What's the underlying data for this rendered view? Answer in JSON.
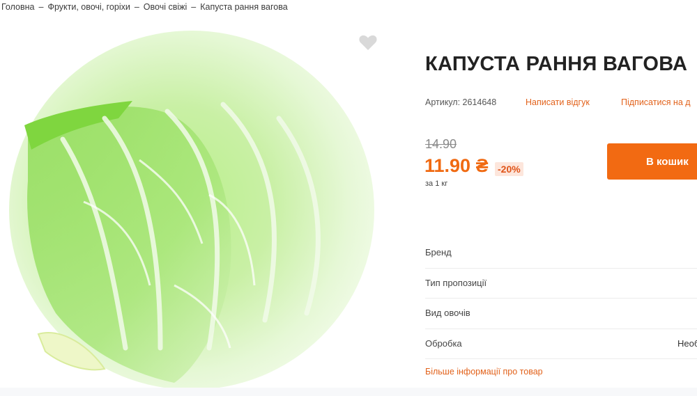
{
  "breadcrumb": {
    "items": [
      "Головна",
      "Фрукти, овочі, горіхи",
      "Овочі свіжі"
    ],
    "separator": "–",
    "current": "Капуста рання вагова"
  },
  "product": {
    "title": "КАПУСТА РАННЯ ВАГОВА",
    "sku": "Артикул: 2614648",
    "review_link": "Написати відгук",
    "subscribe_link": "Підписатися на д",
    "old_price": "14.90",
    "price": "11.90 ₴",
    "discount": "-20%",
    "unit": "за 1 кг",
    "cart_button": "В кошик",
    "image_icon": "cabbage-image",
    "wishlist_icon": "heart-icon"
  },
  "attributes": [
    {
      "label": "Бренд",
      "value": ""
    },
    {
      "label": "Тип пропозиції",
      "value": ""
    },
    {
      "label": "Вид овочів",
      "value": ""
    },
    {
      "label": "Обробка",
      "value": "Необ"
    }
  ],
  "more_info_link": "Більше інформації про товар",
  "colors": {
    "accent": "#f26a12",
    "link": "#e2621b",
    "discount_bg": "#fde6dc"
  }
}
